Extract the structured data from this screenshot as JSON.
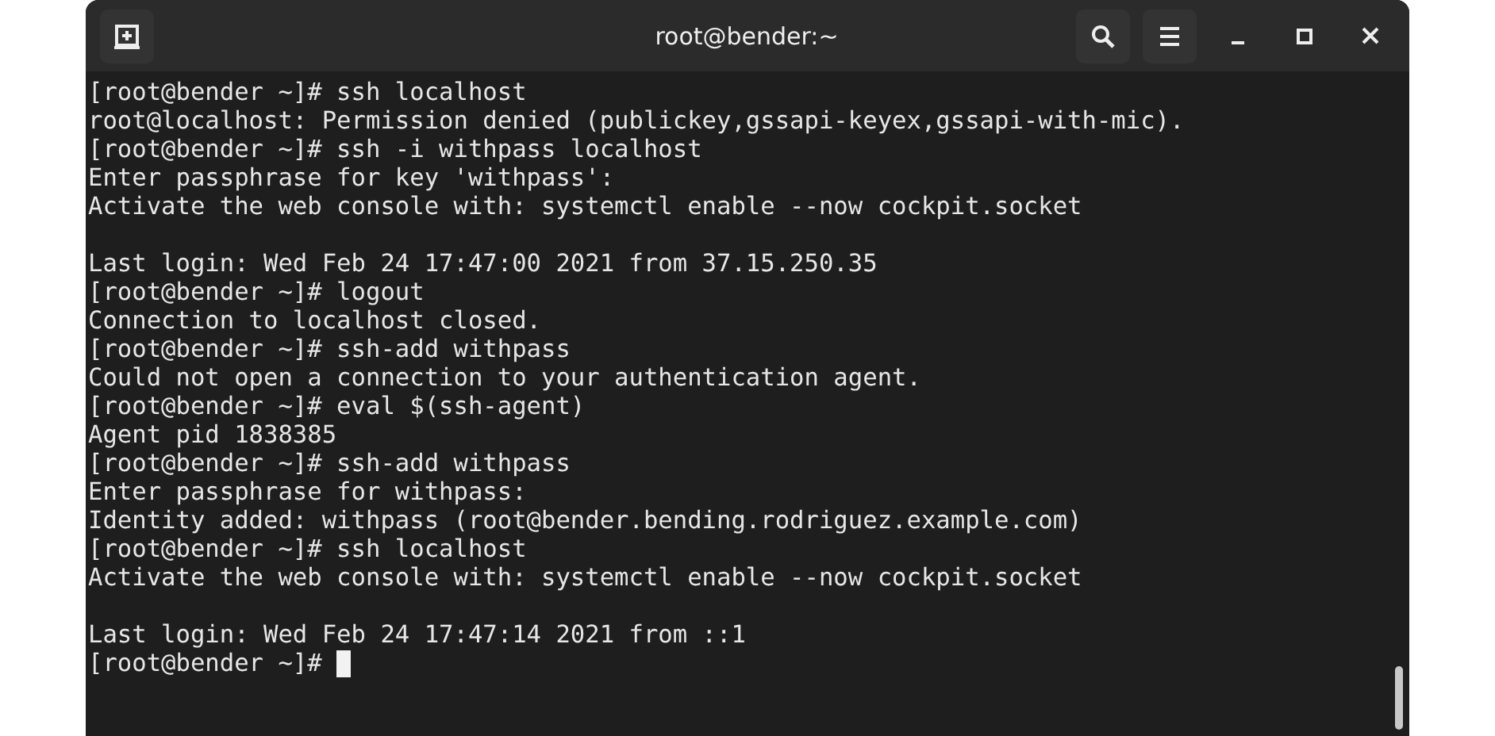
{
  "window": {
    "title": "root@bender:~"
  },
  "terminal": {
    "lines": [
      {
        "kind": "text",
        "text": "[root@bender ~]# ssh localhost"
      },
      {
        "kind": "text",
        "text": "root@localhost: Permission denied (publickey,gssapi-keyex,gssapi-with-mic)."
      },
      {
        "kind": "text",
        "text": "[root@bender ~]# ssh -i withpass localhost"
      },
      {
        "kind": "text",
        "text": "Enter passphrase for key 'withpass':"
      },
      {
        "kind": "text",
        "text": "Activate the web console with: systemctl enable --now cockpit.socket"
      },
      {
        "kind": "blank"
      },
      {
        "kind": "text",
        "text": "Last login: Wed Feb 24 17:47:00 2021 from 37.15.250.35"
      },
      {
        "kind": "text",
        "text": "[root@bender ~]# logout"
      },
      {
        "kind": "text",
        "text": "Connection to localhost closed."
      },
      {
        "kind": "text",
        "text": "[root@bender ~]# ssh-add withpass"
      },
      {
        "kind": "text",
        "text": "Could not open a connection to your authentication agent."
      },
      {
        "kind": "text",
        "text": "[root@bender ~]# eval $(ssh-agent)"
      },
      {
        "kind": "text",
        "text": "Agent pid 1838385"
      },
      {
        "kind": "text",
        "text": "[root@bender ~]# ssh-add withpass"
      },
      {
        "kind": "text",
        "text": "Enter passphrase for withpass:"
      },
      {
        "kind": "text",
        "text": "Identity added: withpass (root@bender.bending.rodriguez.example.com)"
      },
      {
        "kind": "text",
        "text": "[root@bender ~]# ssh localhost"
      },
      {
        "kind": "text",
        "text": "Activate the web console with: systemctl enable --now cockpit.socket"
      },
      {
        "kind": "blank"
      },
      {
        "kind": "text",
        "text": "Last login: Wed Feb 24 17:47:14 2021 from ::1"
      },
      {
        "kind": "prompt",
        "text": "[root@bender ~]#"
      }
    ]
  }
}
